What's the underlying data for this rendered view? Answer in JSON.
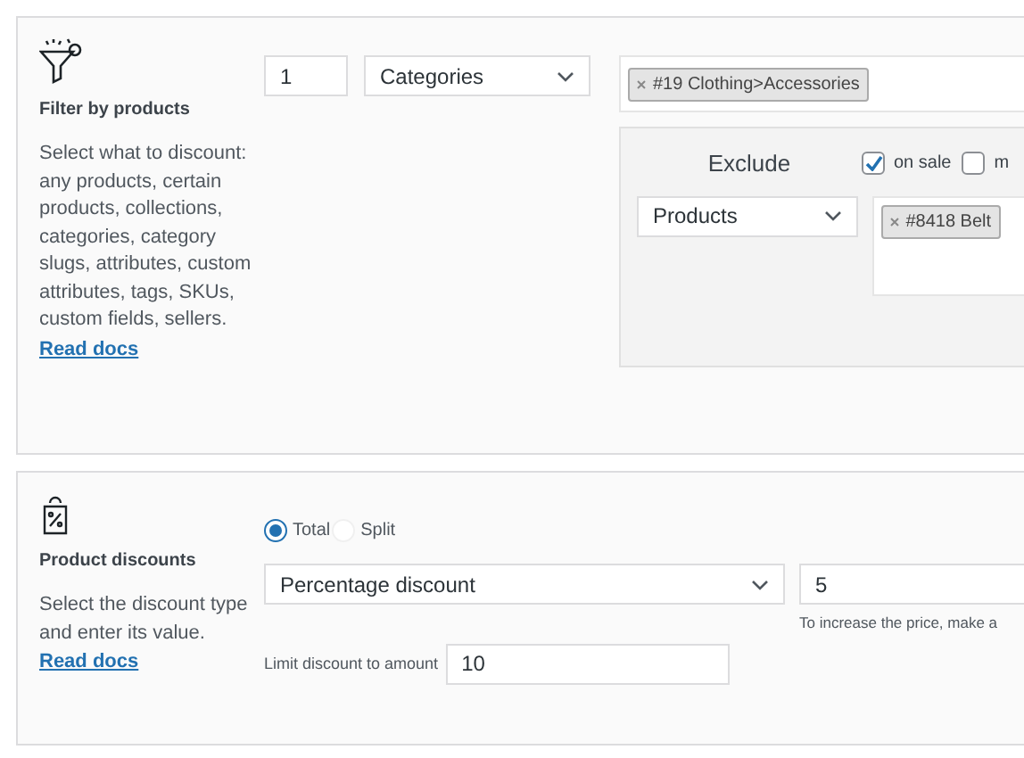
{
  "filter_panel": {
    "title": "Filter by products",
    "description": "Select what to discount: any products, certain products, collections, categories, category slugs, attributes, custom attributes, tags, SKUs, custom fields, sellers.",
    "link": "Read docs",
    "quantity": "1",
    "type_select": "Categories",
    "tags": [
      "#19 Clothing>Accessories"
    ],
    "exclude": {
      "title": "Exclude",
      "checkboxes": [
        {
          "label": "on sale",
          "checked": true
        },
        {
          "label": "m",
          "checked": false
        }
      ],
      "type_select": "Products",
      "tags": [
        "#8418 Belt"
      ]
    }
  },
  "discount_panel": {
    "title": "Product discounts",
    "description": "Select the discount type and enter its value.",
    "link": "Read docs",
    "modes": [
      {
        "label": "Total",
        "selected": true
      },
      {
        "label": "Split",
        "selected": false
      }
    ],
    "type_select": "Percentage discount",
    "value": "5",
    "hint": "To increase the price, make a",
    "limit_label": "Limit discount to amount",
    "limit_value": "10"
  }
}
